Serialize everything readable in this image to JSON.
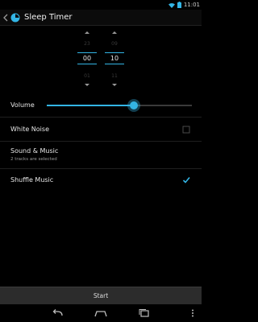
{
  "status_bar": {
    "time": "11:01",
    "icons": [
      "wifi-icon",
      "battery-icon"
    ]
  },
  "action_bar": {
    "title": "Sleep Timer",
    "icons": [
      "up-caret-icon",
      "app-timer-icon"
    ]
  },
  "timer": {
    "hours": {
      "above": "23",
      "value": "00",
      "below": "01"
    },
    "minutes": {
      "above": "09",
      "value": "10",
      "below": "11"
    }
  },
  "settings": {
    "volume": {
      "label": "Volume",
      "level": 0.6
    },
    "white_noise": {
      "label": "White Noise",
      "checked": false
    },
    "sound_music": {
      "label": "Sound & Music",
      "subtitle": "2 tracks are selected"
    },
    "shuffle_music": {
      "label": "Shuffle Music",
      "checked": true
    }
  },
  "start_button": {
    "label": "Start"
  },
  "nav_bar": {
    "icons": [
      "back-icon",
      "home-icon",
      "recent-apps-icon",
      "menu-icon"
    ]
  },
  "colors": {
    "accent": "#33b5e5",
    "background": "#000000",
    "button": "#2c2c2c"
  }
}
